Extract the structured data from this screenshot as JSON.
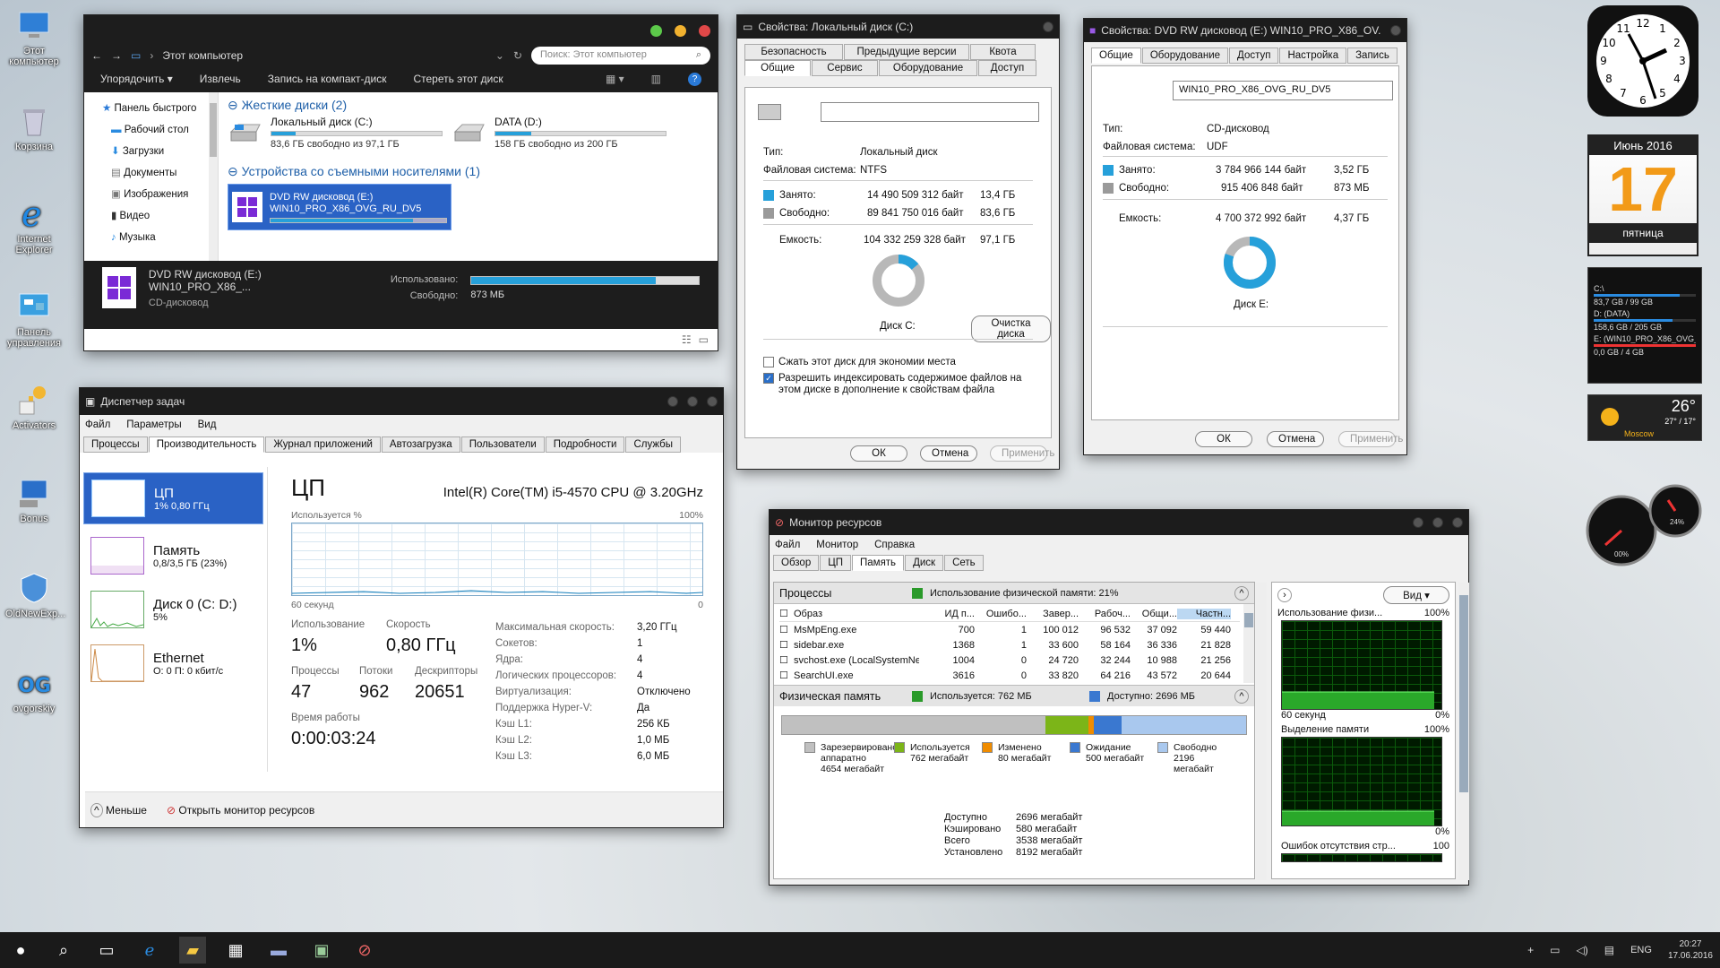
{
  "desktop_icons": [
    "Этот компьютер",
    "Корзина",
    "Internet Explorer",
    "Панель управления",
    "Activators",
    "Bonus",
    "OldNewExp...",
    "ovgorskiy"
  ],
  "explorer": {
    "address": "Этот компьютер",
    "search_placeholder": "Поиск: Этот компьютер",
    "toolbar": [
      "Упорядочить ▾",
      "Извлечь",
      "Запись на компакт-диск",
      "Стереть этот диск"
    ],
    "nav": [
      "Панель быстрого",
      "Рабочий стол",
      "Загрузки",
      "Документы",
      "Изображения",
      "Видео",
      "Музыка"
    ],
    "hdd_group": "Жесткие диски (2)",
    "drive_c": {
      "name": "Локальный диск (C:)",
      "free": "83,6 ГБ свободно из 97,1 ГБ",
      "used": 0.14
    },
    "drive_d": {
      "name": "DATA (D:)",
      "free": "158 ГБ свободно из 200 ГБ",
      "used": 0.21
    },
    "removable_group": "Устройства со съемными носителями (1)",
    "dvd": {
      "line1": "DVD RW дисковод (E:)",
      "line2": "WIN10_PRO_X86_OVG_RU_DV5",
      "used": 0.81
    },
    "details": {
      "title": "DVD RW дисковод (E:) WIN10_PRO_X86_...",
      "type": "CD-дисковод",
      "used_label": "Использовано:",
      "free_label": "Свободно:",
      "free_value": "873 МБ",
      "used": 0.81
    }
  },
  "propc": {
    "title": "Свойства: Локальный диск (C:)",
    "tabs_row1": [
      "Безопасность",
      "Предыдущие версии",
      "Квота"
    ],
    "tabs_row2": [
      "Общие",
      "Сервис",
      "Оборудование",
      "Доступ"
    ],
    "type_label": "Тип:",
    "type_value": "Локальный диск",
    "fs_label": "Файловая система:",
    "fs_value": "NTFS",
    "used_label": "Занято:",
    "used_bytes": "14 490 509 312 байт",
    "used_h": "13,4 ГБ",
    "free_label": "Свободно:",
    "free_bytes": "89 841 750 016 байт",
    "free_h": "83,6 ГБ",
    "cap_label": "Емкость:",
    "cap_bytes": "104 332 259 328 байт",
    "cap_h": "97,1 ГБ",
    "disk_label": "Диск C:",
    "cleanup": "Очистка диска",
    "compress": "Сжать этот диск для экономии места",
    "index": "Разрешить индексировать содержимое файлов на этом диске в дополнение к свойствам файла",
    "ok": "ОК",
    "cancel": "Отмена",
    "apply": "Применить",
    "used_fraction": 0.139
  },
  "prope": {
    "title": "Свойства: DVD RW дисковод (E:) WIN10_PRO_X86_OV...",
    "tabs": [
      "Общие",
      "Оборудование",
      "Доступ",
      "Настройка",
      "Запись"
    ],
    "label": "WIN10_PRO_X86_OVG_RU_DV5",
    "type_label": "Тип:",
    "type_value": "CD-дисковод",
    "fs_label": "Файловая система:",
    "fs_value": "UDF",
    "used_label": "Занято:",
    "used_bytes": "3 784 966 144 байт",
    "used_h": "3,52 ГБ",
    "free_label": "Свободно:",
    "free_bytes": "915 406 848 байт",
    "free_h": "873 МБ",
    "cap_label": "Емкость:",
    "cap_bytes": "4 700 372 992 байт",
    "cap_h": "4,37 ГБ",
    "disk_label": "Диск E:",
    "ok": "ОК",
    "cancel": "Отмена",
    "apply": "Применить",
    "used_fraction": 0.805
  },
  "taskmgr": {
    "title": "Диспетчер задач",
    "menu": [
      "Файл",
      "Параметры",
      "Вид"
    ],
    "tabs": [
      "Процессы",
      "Производительность",
      "Журнал приложений",
      "Автозагрузка",
      "Пользователи",
      "Подробности",
      "Службы"
    ],
    "side": [
      {
        "name": "ЦП",
        "sub": "1% 0,80 ГГц"
      },
      {
        "name": "Память",
        "sub": "0,8/3,5 ГБ (23%)"
      },
      {
        "name": "Диск 0 (C: D:)",
        "sub": "5%"
      },
      {
        "name": "Ethernet",
        "sub": "О: 0 П: 0 кбит/с"
      }
    ],
    "heading": "ЦП",
    "cpu_name": "Intel(R) Core(TM) i5-4570 CPU @ 3.20GHz",
    "usage_label": "Используется %",
    "pct100": "100%",
    "sec60": "60 секунд",
    "zero": "0",
    "stats": [
      {
        "l": "Использование",
        "v": "1%"
      },
      {
        "l": "Скорость",
        "v": "0,80 ГГц"
      },
      {
        "l": "Процессы",
        "v": "47"
      },
      {
        "l": "Потоки",
        "v": "962"
      },
      {
        "l": "Дескрипторы",
        "v": "20651"
      }
    ],
    "uptime_label": "Время работы",
    "uptime": "0:00:03:24",
    "info": [
      [
        "Максимальная скорость:",
        "3,20 ГГц"
      ],
      [
        "Сокетов:",
        "1"
      ],
      [
        "Ядра:",
        "4"
      ],
      [
        "Логических процессоров:",
        "4"
      ],
      [
        "Виртуализация:",
        "Отключено"
      ],
      [
        "Поддержка Hyper-V:",
        "Да"
      ],
      [
        "Кэш L1:",
        "256 КБ"
      ],
      [
        "Кэш L2:",
        "1,0 МБ"
      ],
      [
        "Кэш L3:",
        "6,0 МБ"
      ]
    ],
    "less": "Меньше",
    "open_monitor": "Открыть монитор ресурсов"
  },
  "resmon": {
    "title": "Монитор ресурсов",
    "menu": [
      "Файл",
      "Монитор",
      "Справка"
    ],
    "tabs": [
      "Обзор",
      "ЦП",
      "Память",
      "Диск",
      "Сеть"
    ],
    "proc_header": "Процессы",
    "proc_usage": "Использование физической памяти: 21%",
    "cols": [
      "Образ",
      "ИД п...",
      "Ошибо...",
      "Завер...",
      "Рабоч...",
      "Общи...",
      "Частн..."
    ],
    "rows": [
      [
        "MsMpEng.exe",
        "700",
        "1",
        "100 012",
        "96 532",
        "37 092",
        "59 440"
      ],
      [
        "sidebar.exe",
        "1368",
        "1",
        "33 600",
        "58 164",
        "36 336",
        "21 828"
      ],
      [
        "svchost.exe (LocalSystemNet...",
        "1004",
        "0",
        "24 720",
        "32 244",
        "10 988",
        "21 256"
      ],
      [
        "SearchUI.exe",
        "3616",
        "0",
        "33 820",
        "64 216",
        "43 572",
        "20 644"
      ]
    ],
    "phys_header": "Физическая память",
    "phys_used": "Используется: 762 МБ",
    "phys_avail": "Доступно: 2696 МБ",
    "legend": [
      {
        "name": "Зарезервировано аппаратно",
        "val": "4654 мегабайт",
        "color": "#c0c0c0"
      },
      {
        "name": "Используется",
        "val": "762 мегабайт",
        "color": "#7cb518"
      },
      {
        "name": "Изменено",
        "val": "80 мегабайт",
        "color": "#f08c00"
      },
      {
        "name": "Ожидание",
        "val": "500 мегабайт",
        "color": "#3a78d0"
      },
      {
        "name": "Свободно",
        "val": "2196 мегабайт",
        "color": "#a9c8ee"
      }
    ],
    "summary": [
      [
        "Доступно",
        "2696 мегабайт"
      ],
      [
        "Кэшировано",
        "580 мегабайт"
      ],
      [
        "Всего",
        "3538 мегабайт"
      ],
      [
        "Установлено",
        "8192 мегабайт"
      ]
    ],
    "view": "Вид",
    "g1": "Использование физи...",
    "g1pct": "100%",
    "g1sec": "60 секунд",
    "g1zero": "0%",
    "g2": "Выделение памяти",
    "g2pct": "100%",
    "g2zero": "0%",
    "g3": "Ошибок отсутствия стр...",
    "g3val": "100"
  },
  "gadgets": {
    "cal_month": "Июнь 2016",
    "cal_day": "17",
    "cal_weekday": "пятница",
    "drives": [
      {
        "name": "C:\\",
        "info": "83,7 GB / 99 GB"
      },
      {
        "name": "D: (DATA)",
        "info": "158,6 GB / 205 GB"
      },
      {
        "name": "E: (WIN10_PRO_X86_OVG_RU_DV...",
        "info": "0,0 GB / 4 GB"
      }
    ],
    "weather_temp": "26°",
    "weather_range": "27° / 17°",
    "weather_city": "Moscow",
    "meter1": "00%",
    "meter2": "24%"
  },
  "taskbar": {
    "lang": "ENG",
    "time": "20:27",
    "date": "17.06.2016"
  }
}
